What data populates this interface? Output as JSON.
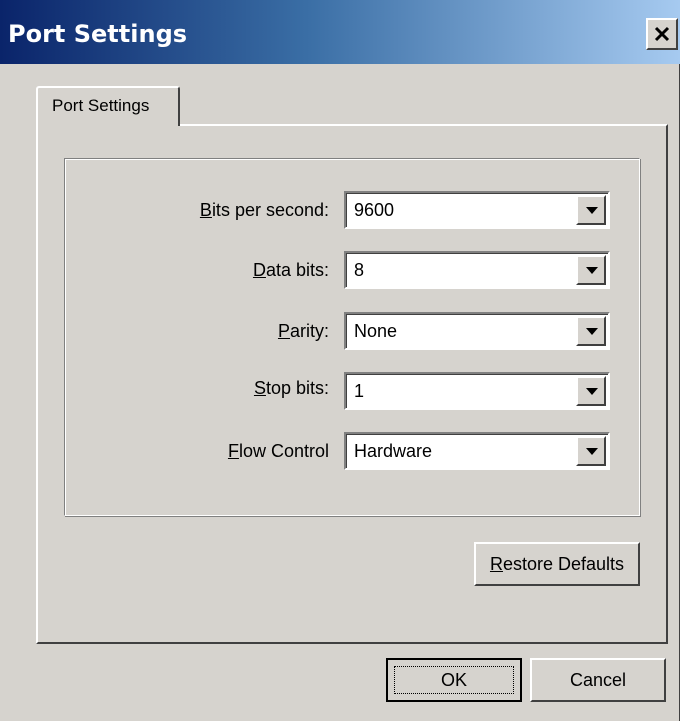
{
  "window": {
    "title": "Port Settings"
  },
  "tabs": [
    {
      "label": "Port Settings",
      "selected": true
    }
  ],
  "fields": {
    "bits_per_second": {
      "label_mnemonic": "B",
      "label_rest": "its per second:",
      "value": "9600"
    },
    "data_bits": {
      "label_mnemonic": "D",
      "label_rest": "ata bits:",
      "value": "8"
    },
    "parity": {
      "label_mnemonic": "P",
      "label_rest": "arity:",
      "value": "None"
    },
    "stop_bits": {
      "label_mnemonic": "S",
      "label_rest": "top bits:",
      "value": "1"
    },
    "flow_control": {
      "label_mnemonic": "F",
      "label_rest": "low Control",
      "value": "Hardware"
    }
  },
  "buttons": {
    "restore_mnemonic": "R",
    "restore_rest": "estore Defaults",
    "ok": "OK",
    "cancel": "Cancel"
  },
  "icons": {
    "close": "close-icon",
    "dropdown": "chevron-down-icon"
  },
  "colors": {
    "titlebar_start": "#0a246a",
    "titlebar_end": "#a6caf0",
    "face": "#d6d3ce"
  }
}
